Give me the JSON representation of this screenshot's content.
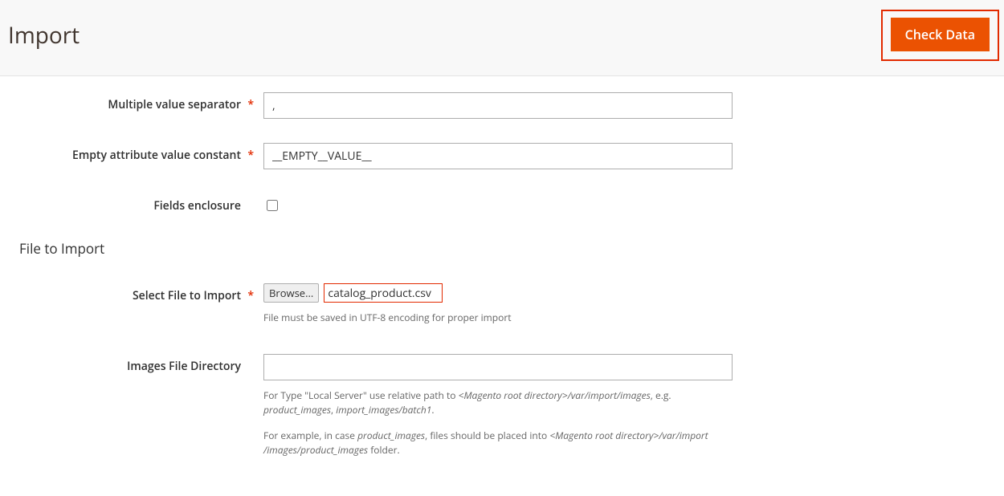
{
  "header": {
    "title": "Import",
    "check_data_label": "Check Data"
  },
  "fields": {
    "multiple_value_separator": {
      "label": "Multiple value separator",
      "value": ","
    },
    "empty_attribute_value_constant": {
      "label": "Empty attribute value constant",
      "value": "__EMPTY__VALUE__"
    },
    "fields_enclosure": {
      "label": "Fields enclosure"
    }
  },
  "section": {
    "file_to_import_title": "File to Import"
  },
  "file_select": {
    "label": "Select File to Import",
    "browse_label": "Browse...",
    "filename": "catalog_product.csv",
    "hint": "File must be saved in UTF-8 encoding for proper import"
  },
  "images_dir": {
    "label": "Images File Directory",
    "value": "",
    "hint1_a": "For Type \"Local Server\" use relative path to ",
    "hint1_b": "<Magento root directory>/var/import/images",
    "hint1_c": ", e.g. ",
    "hint1_d": "product_images",
    "hint1_e": ", ",
    "hint1_f": "import_images/batch1",
    "hint1_g": ".",
    "hint2_a": "For example, in case ",
    "hint2_b": "product_images",
    "hint2_c": ", files should be placed into ",
    "hint2_d": "<Magento root directory>/var/import",
    "hint2_e": "/images/product_images",
    "hint2_f": " folder."
  }
}
